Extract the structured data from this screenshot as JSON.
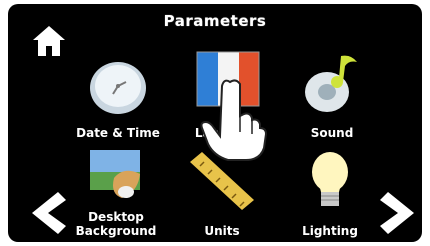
{
  "header": {
    "title": "Parameters",
    "home_icon": "home-icon"
  },
  "tiles": [
    {
      "label": "Date & Time",
      "icon": "clock-icon"
    },
    {
      "label": "Language",
      "icon": "flag-icon"
    },
    {
      "label": "Sound",
      "icon": "music-note-icon"
    },
    {
      "label": "Desktop Background",
      "icon": "desktop-background-icon"
    },
    {
      "label": "Units",
      "icon": "ruler-icon"
    },
    {
      "label": "Lighting",
      "icon": "light-bulb-icon"
    }
  ],
  "navigation": {
    "prev_icon": "left-arrow-icon",
    "next_icon": "right-arrow-icon"
  },
  "overlay": {
    "icon": "hand-pointer-icon"
  }
}
